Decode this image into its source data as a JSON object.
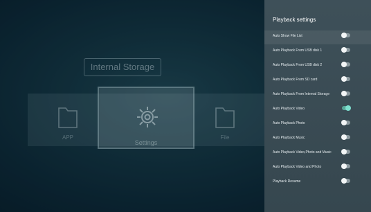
{
  "main": {
    "storage_title": "Internal Storage",
    "tiles": [
      {
        "label": "APP",
        "icon": "folder-icon"
      },
      {
        "label": "Settings",
        "icon": "gear-icon"
      },
      {
        "label": "File",
        "icon": "folder-icon"
      }
    ]
  },
  "panel": {
    "title": "Playback settings",
    "items": [
      {
        "label": "Auto Show File List",
        "enabled": false
      },
      {
        "label": "Auto Playback From USB disk 1",
        "enabled": false
      },
      {
        "label": "Auto Playback From USB disk 2",
        "enabled": false
      },
      {
        "label": "Auto Playback From SD card",
        "enabled": false
      },
      {
        "label": "Auto Playback From Internal Storage",
        "enabled": false
      },
      {
        "label": "Auto Playback Video",
        "enabled": true
      },
      {
        "label": "Auto Playback Photo",
        "enabled": false
      },
      {
        "label": "Auto Playback Music",
        "enabled": false
      },
      {
        "label": "Auto Playback Video,Photo and Music",
        "enabled": false
      },
      {
        "label": "Auto Playback Video and Photo",
        "enabled": false
      },
      {
        "label": "Playback Resume",
        "enabled": false
      }
    ]
  },
  "colors": {
    "toggle_on": "#7ee0cf",
    "panel_bg": "#3e5059",
    "background": "#143542"
  }
}
